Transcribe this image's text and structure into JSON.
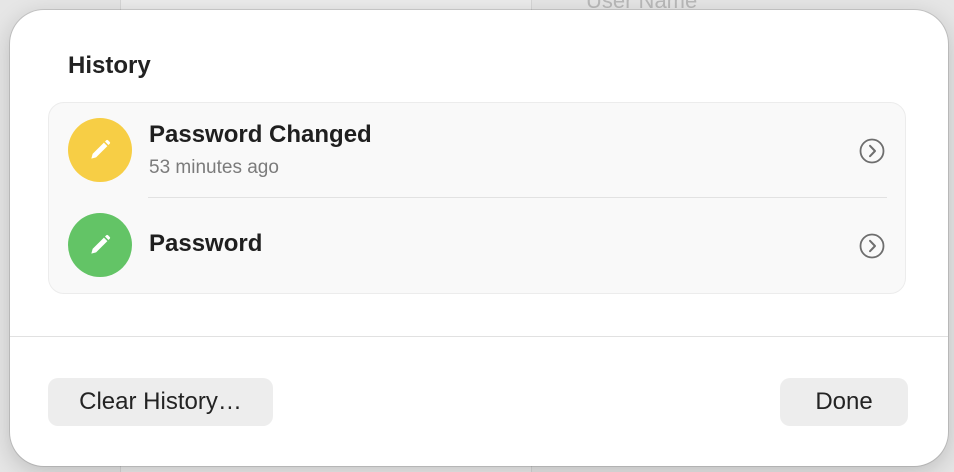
{
  "background": {
    "partial_text": "User Name"
  },
  "dialog": {
    "title": "History",
    "items": [
      {
        "title": "Password Changed",
        "subtitle": "53 minutes ago",
        "icon": "pencil-icon",
        "icon_color": "#F7CE45"
      },
      {
        "title": "Password",
        "subtitle": "",
        "icon": "pencil-icon",
        "icon_color": "#63C466"
      }
    ],
    "buttons": {
      "clear_history": "Clear History…",
      "done": "Done"
    }
  }
}
